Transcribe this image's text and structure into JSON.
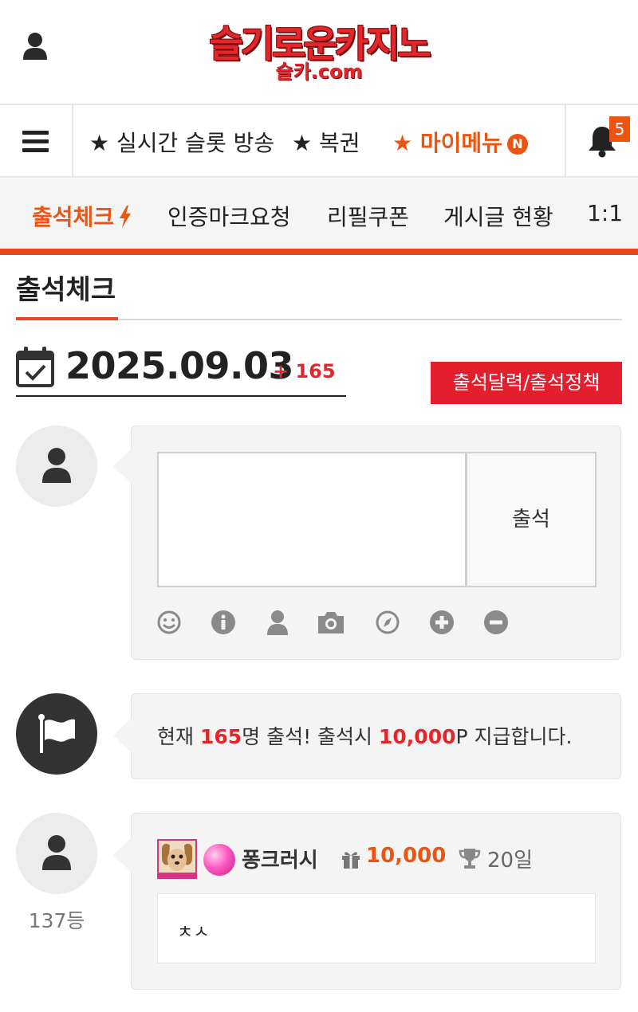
{
  "header": {
    "logo_main": "슬기로운카지노",
    "logo_sub": "슬카.com",
    "user_icon": "user-icon"
  },
  "nav_primary": {
    "menu_icon": "hamburger-icon",
    "items": [
      {
        "label": "★ 실시간 슬롯 방송"
      },
      {
        "label": "★ 복권"
      },
      {
        "label": "★ 마이메뉴"
      }
    ],
    "mymenu_badge": "N",
    "bell_icon": "bell-icon",
    "notification_count": "5"
  },
  "nav_secondary": {
    "items": [
      {
        "label": "출석체크",
        "active": true
      },
      {
        "label": "인증마크요청"
      },
      {
        "label": "리필쿠폰"
      },
      {
        "label": "게시글 현황"
      },
      {
        "label": "1:1"
      }
    ],
    "active_icon": "lightning-icon"
  },
  "page": {
    "title": "출석체크",
    "date": "2025.09.03",
    "attendee_delta": "+ 165",
    "calendar_button": "출석달력/출석정책"
  },
  "write_form": {
    "input_value": "",
    "submit_label": "출석",
    "tools": [
      "smile-icon",
      "info-icon",
      "user-icon",
      "camera-icon",
      "compass-icon",
      "plus-circle-icon",
      "minus-circle-icon"
    ]
  },
  "notice": {
    "prefix": "현재 ",
    "count": "165",
    "middle": "명 출석! 출석시 ",
    "points": "10,000",
    "suffix": "P 지급합니다."
  },
  "entries": [
    {
      "rank": "137등",
      "nickname": "퐁크러시",
      "points": "10,000",
      "days": "20일",
      "comment": "ㅊㅅ"
    }
  ],
  "colors": {
    "accent_orange": "#ea5512",
    "accent_red": "#e31e2d",
    "bar_red": "#e8461c"
  }
}
